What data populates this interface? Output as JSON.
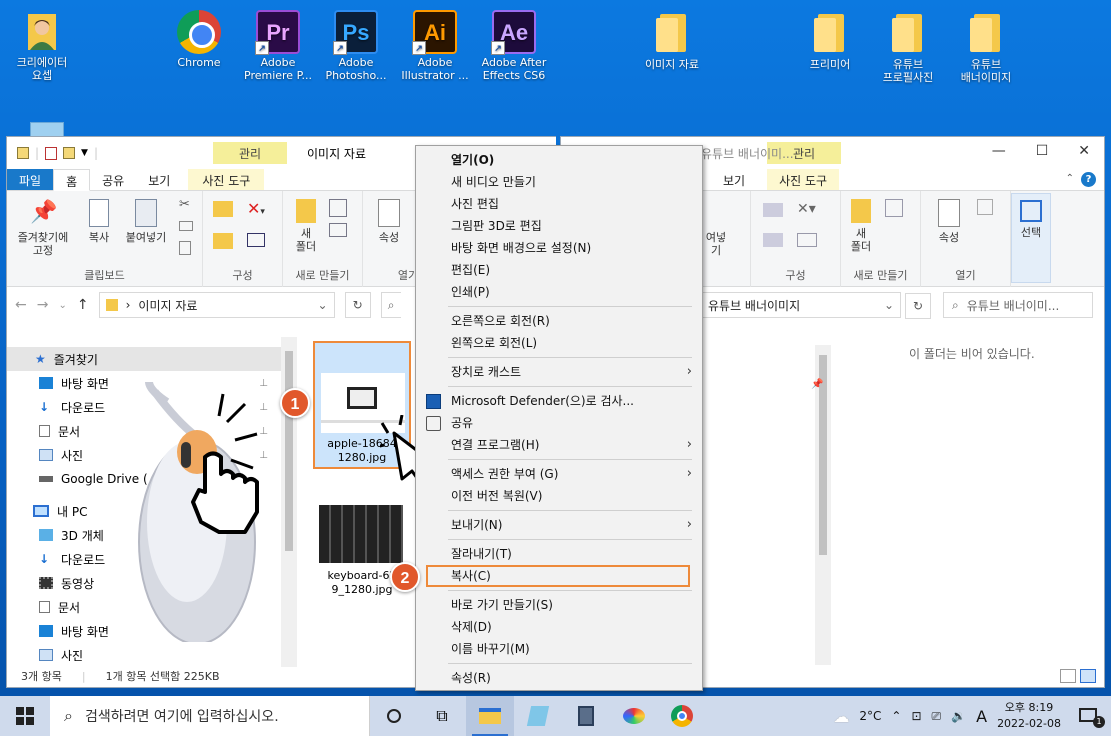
{
  "desktop": {
    "icons": [
      {
        "label": "크리에이터\n요셉",
        "icon": "user-icon"
      },
      {
        "label": "Chrome",
        "icon": "chrome-icon"
      },
      {
        "label": "Adobe\nPremiere P...",
        "icon": "premiere-icon",
        "glyph": "Pr",
        "color": "#2a0b47",
        "fg": "#e9a6ff"
      },
      {
        "label": "Adobe\nPhotosho...",
        "icon": "photoshop-icon",
        "glyph": "Ps",
        "color": "#0a1f3a",
        "fg": "#36a8ff"
      },
      {
        "label": "Adobe\nIllustrator ...",
        "icon": "illustrator-icon",
        "glyph": "Ai",
        "color": "#2b1500",
        "fg": "#ff9a00"
      },
      {
        "label": "Adobe After\nEffects CS6",
        "icon": "aftereffects-icon",
        "glyph": "Ae",
        "color": "#1d0b3b",
        "fg": "#c9a6ff"
      },
      {
        "label": "이미지 자료",
        "icon": "folder-icon"
      },
      {
        "label": "프리미어",
        "icon": "folder-icon"
      },
      {
        "label": "유튜브\n프로필사진",
        "icon": "folder-icon"
      },
      {
        "label": "유튜브\n배너이미지",
        "icon": "folder-icon"
      }
    ]
  },
  "explorer_left": {
    "title": "이미지 자료",
    "manage_tab": "관리",
    "tabs": [
      "파일",
      "홈",
      "공유",
      "보기",
      "사진 도구"
    ],
    "ribbon": {
      "pin_label": "즐겨찾기에\n고정",
      "copy_label": "복사",
      "paste_label": "붙여넣기",
      "clipboard_group": "클립보드",
      "organize_group": "구성",
      "new_folder_label": "새\n폴더",
      "new_group": "새로 만들기",
      "properties_label": "속성",
      "open_group": "열기"
    },
    "address": "이미지 자료",
    "nav": {
      "favorites": "즐겨찾기",
      "items": [
        {
          "label": "바탕 화면",
          "icon": "desktop-icon"
        },
        {
          "label": "다운로드",
          "icon": "download-icon"
        },
        {
          "label": "문서",
          "icon": "document-icon"
        },
        {
          "label": "사진",
          "icon": "pictures-icon"
        },
        {
          "label": "Google Drive (",
          "icon": "drive-icon"
        }
      ],
      "this_pc": "내 PC",
      "pc_items": [
        {
          "label": "3D 개체",
          "icon": "3d-objects-icon"
        },
        {
          "label": "다운로드",
          "icon": "download-icon"
        },
        {
          "label": "동영상",
          "icon": "video-icon"
        },
        {
          "label": "문서",
          "icon": "document-icon"
        },
        {
          "label": "바탕 화면",
          "icon": "desktop-icon"
        },
        {
          "label": "사진",
          "icon": "pictures-icon"
        }
      ]
    },
    "files": [
      {
        "name": "apple-1868496_\n1280.jpg",
        "shown": "apple-18684\n1280.jpg"
      },
      {
        "name": "keyboard-62\n9_1280.jpg",
        "shown": "keyboard-62\n9_1280.jpg"
      }
    ],
    "status": {
      "count": "3개 항목",
      "selected": "1개 항목 선택함 225KB"
    }
  },
  "explorer_right": {
    "title": "유튜브 배너이미...",
    "manage_tab": "관리",
    "tabs": [
      "보기",
      "사진 도구"
    ],
    "ribbon": {
      "copy_label_partial": "여넣기",
      "organize_group": "구성",
      "new_folder_label": "새\n폴더",
      "new_group": "새로 만들기",
      "properties_label": "속성",
      "open_group": "열기",
      "select_label": "선택"
    },
    "address": "유튜브 배너이미지",
    "search_placeholder": "유튜브 배너이미...",
    "empty_text": "이 폴더는 비어 있습니다."
  },
  "context_menu": {
    "items": [
      {
        "label": "열기(O)",
        "bold": true
      },
      {
        "label": "새 비디오 만들기"
      },
      {
        "label": "사진 편집"
      },
      {
        "label": "그림판 3D로 편집"
      },
      {
        "label": "바탕 화면 배경으로 설정(N)"
      },
      {
        "label": "편집(E)"
      },
      {
        "label": "인쇄(P)"
      },
      {
        "sep": true
      },
      {
        "label": "오른쪽으로 회전(R)"
      },
      {
        "label": "왼쪽으로 회전(L)"
      },
      {
        "sep": true
      },
      {
        "label": "장치로 캐스트",
        "submenu": true
      },
      {
        "sep": true
      },
      {
        "label": "Microsoft Defender(으)로 검사...",
        "icon": "defender-icon"
      },
      {
        "label": "공유",
        "icon": "share-icon"
      },
      {
        "label": "연결 프로그램(H)",
        "submenu": true
      },
      {
        "sep": true
      },
      {
        "label": "액세스 권한 부여 (G)",
        "submenu": true
      },
      {
        "label": "이전 버전 복원(V)"
      },
      {
        "sep": true
      },
      {
        "label": "보내기(N)",
        "submenu": true
      },
      {
        "sep": true
      },
      {
        "label": "잘라내기(T)"
      },
      {
        "label": "복사(C)",
        "highlight": true
      },
      {
        "sep": true
      },
      {
        "label": "바로 가기 만들기(S)"
      },
      {
        "label": "삭제(D)"
      },
      {
        "label": "이름 바꾸기(M)"
      },
      {
        "sep": true
      },
      {
        "label": "속성(R)"
      }
    ]
  },
  "badges": [
    "1",
    "2"
  ],
  "taskbar": {
    "search_placeholder": "검색하려면 여기에 입력하십시오.",
    "weather": "2°C",
    "ime": "A",
    "time": "오후 8:19",
    "date": "2022-02-08",
    "notification_count": "1"
  }
}
